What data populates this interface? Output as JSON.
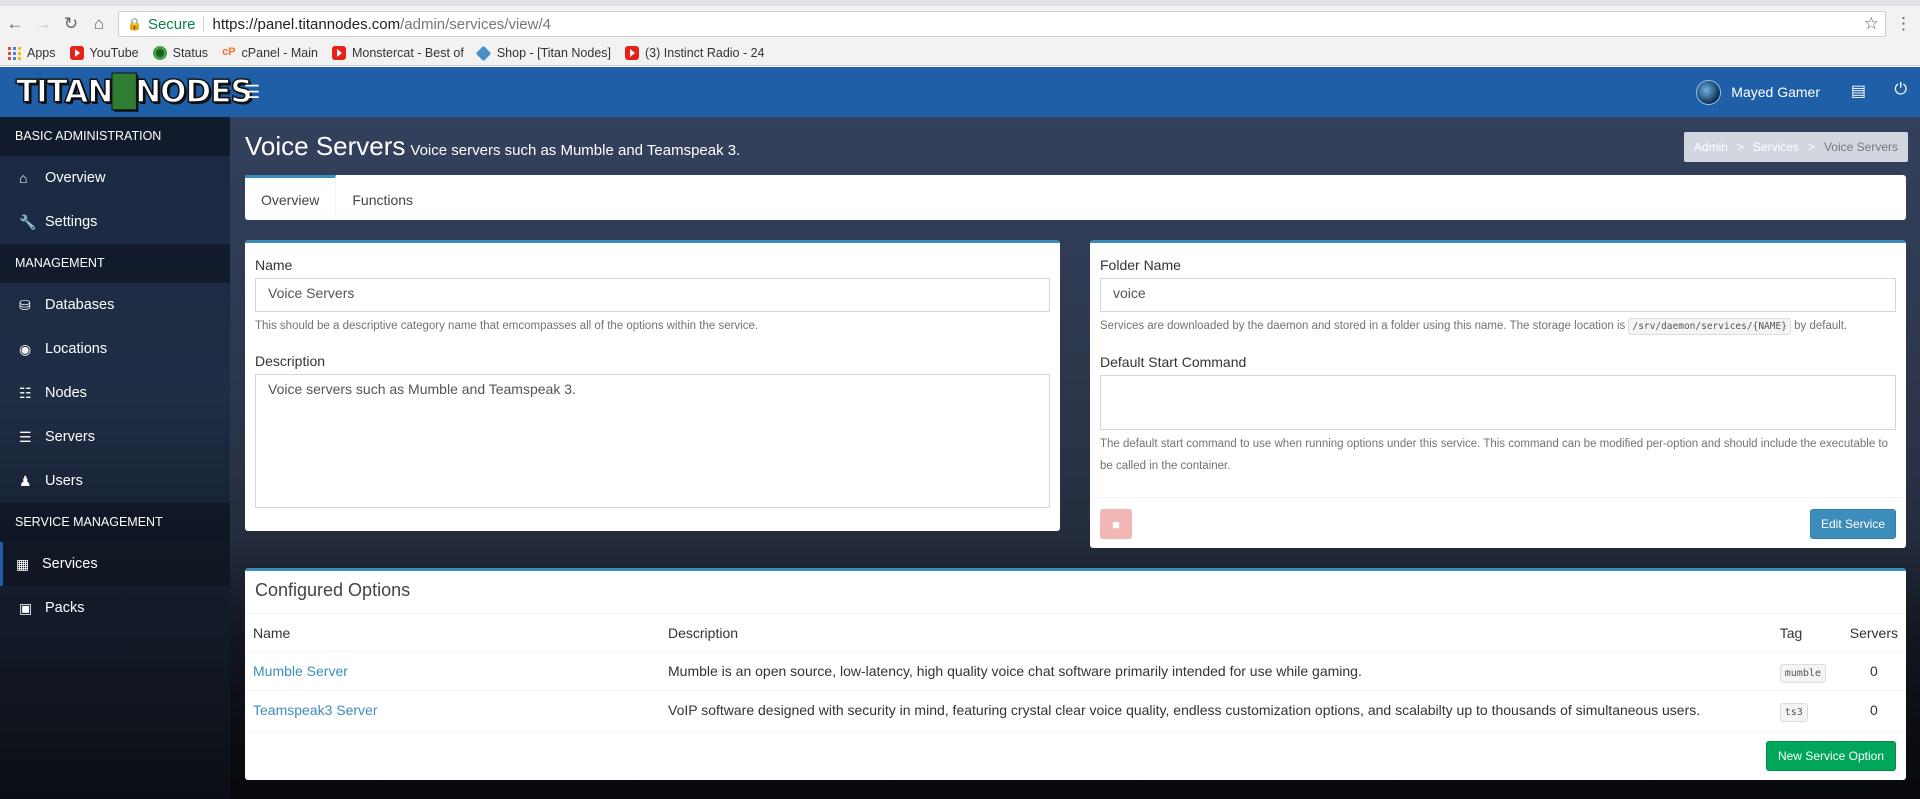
{
  "browser": {
    "secure_label": "Secure",
    "url_host": "https://panel.titannodes.com",
    "url_path": "/admin/services/view/4",
    "bookmarks": [
      {
        "label": "Apps"
      },
      {
        "label": "YouTube"
      },
      {
        "label": "Status"
      },
      {
        "label": "cPanel - Main"
      },
      {
        "label": "Monstercat - Best of"
      },
      {
        "label": "Shop - [Titan Nodes]"
      },
      {
        "label": "(3) Instinct Radio - 24"
      }
    ]
  },
  "header": {
    "logo_left": "TITAN",
    "logo_right": "NODES",
    "username": "Mayed Gamer"
  },
  "sidebar": {
    "sections": [
      {
        "title": "BASIC ADMINISTRATION",
        "items": [
          {
            "label": "Overview",
            "icon": "home-icon"
          },
          {
            "label": "Settings",
            "icon": "wrench-icon"
          }
        ]
      },
      {
        "title": "MANAGEMENT",
        "items": [
          {
            "label": "Databases",
            "icon": "database-icon"
          },
          {
            "label": "Locations",
            "icon": "globe-icon"
          },
          {
            "label": "Nodes",
            "icon": "sitemap-icon"
          },
          {
            "label": "Servers",
            "icon": "server-icon"
          },
          {
            "label": "Users",
            "icon": "users-icon"
          }
        ]
      },
      {
        "title": "SERVICE MANAGEMENT",
        "items": [
          {
            "label": "Services",
            "icon": "grid-icon"
          },
          {
            "label": "Packs",
            "icon": "archive-icon"
          }
        ]
      }
    ]
  },
  "page": {
    "title": "Voice Servers",
    "subtitle": "Voice servers such as Mumble and Teamspeak 3.",
    "breadcrumb": [
      "Admin",
      "Services",
      "Voice Servers"
    ],
    "tabs": [
      "Overview",
      "Functions"
    ]
  },
  "form": {
    "name_label": "Name",
    "name_value": "Voice Servers",
    "name_help": "This should be a descriptive category name that emcompasses all of the options within the service.",
    "description_label": "Description",
    "description_value": "Voice servers such as Mumble and Teamspeak 3.",
    "folder_label": "Folder Name",
    "folder_value": "voice",
    "folder_help_pre": "Services are downloaded by the daemon and stored in a folder using this name. The storage location is",
    "folder_help_code": "/srv/daemon/services/{NAME}",
    "folder_help_post": "by default.",
    "start_label": "Default Start Command",
    "start_value": "",
    "start_help": "The default start command to use when running options under this service. This command can be modified per-option and should include the executable to be called in the container.",
    "edit_button": "Edit Service"
  },
  "options": {
    "title": "Configured Options",
    "columns": [
      "Name",
      "Description",
      "Tag",
      "Servers"
    ],
    "rows": [
      {
        "name": "Mumble Server",
        "description": "Mumble is an open source, low-latency, high quality voice chat software primarily intended for use while gaming.",
        "tag": "mumble",
        "servers": "0"
      },
      {
        "name": "Teamspeak3 Server",
        "description": "VoIP software designed with security in mind, featuring crystal clear voice quality, endless customization options, and scalabilty up to thousands of simultaneous users.",
        "tag": "ts3",
        "servers": "0"
      }
    ],
    "new_button": "New Service Option"
  },
  "colors": {
    "topbar": "#1e5fa8",
    "primary": "#3c8dbc",
    "success": "#00a65a"
  }
}
